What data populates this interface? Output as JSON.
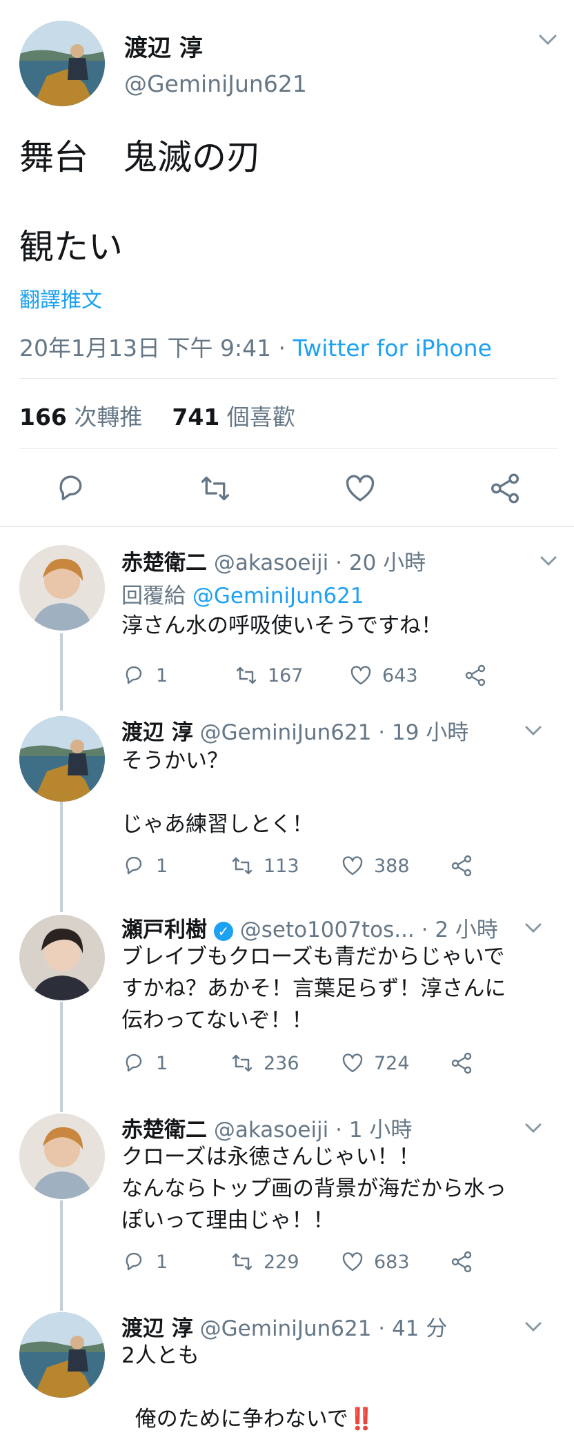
{
  "main_tweet": {
    "author_name": "渡辺 淳",
    "author_handle": "@GeminiJun621",
    "text_line1": "舞台　鬼滅の刃",
    "text_line2": "観たい",
    "translate_label": "翻譯推文",
    "time": "20年1月13日 下午 9:41 · ",
    "source": "Twitter for iPhone",
    "retweets_count": "166",
    "retweets_label": " 次轉推",
    "likes_count": "741",
    "likes_label": " 個喜歡"
  },
  "replies": [
    {
      "name": "赤楚衛二",
      "handle": "@akasoeiji",
      "time": " · 20 小時",
      "reply_to_label": "回覆給 ",
      "reply_to": "@GeminiJun621",
      "text": "淳さん水の呼吸使いそうですね！",
      "replies": "1",
      "retweets": "167",
      "likes": "643"
    },
    {
      "name": "渡辺 淳",
      "handle": "@GeminiJun621",
      "time": " · 19 小時",
      "text": "そうかい？\n\nじゃあ練習しとく！",
      "replies": "1",
      "retweets": "113",
      "likes": "388"
    },
    {
      "name": "瀬戸利樹",
      "handle": "@seto1007tos...",
      "time": " · 2 小時",
      "verified": "✓",
      "text": "ブレイブもクローズも青だからじゃいで\nすかね？あかそ！言葉足らず！淳さんに\n伝わってないぞ！！",
      "replies": "1",
      "retweets": "236",
      "likes": "724"
    },
    {
      "name": "赤楚衛二",
      "handle": "@akasoeiji",
      "time": " · 1 小時",
      "text": "クローズは永徳さんじゃい！！\nなんならトップ画の背景が海だから水っ\nぽいって理由じゃ！！",
      "replies": "1",
      "retweets": "229",
      "likes": "683"
    },
    {
      "name": "渡辺 淳",
      "handle": "@GeminiJun621",
      "time": " · 41 分",
      "text_line1": "2人とも",
      "text_line2": "俺のために争わないで",
      "emoji": "‼️"
    }
  ]
}
